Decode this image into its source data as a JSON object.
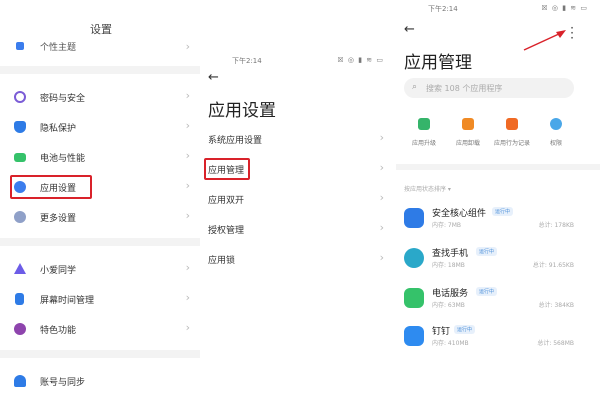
{
  "colors": {
    "highlight": "#d9222a",
    "accent": "#3b7ded"
  },
  "panel1": {
    "title": "设置",
    "cut_row": {
      "label": "个性主题",
      "icon": "brush-icon"
    },
    "groups": [
      [
        {
          "label": "密码与安全",
          "icon": "fingerprint-icon",
          "color": "#7b5cd6"
        },
        {
          "label": "隐私保护",
          "icon": "shield-icon",
          "color": "#2e7be6"
        },
        {
          "label": "电池与性能",
          "icon": "battery-icon",
          "color": "#35c26a"
        },
        {
          "label": "应用设置",
          "icon": "gear-icon",
          "color": "#3b7ded"
        },
        {
          "label": "更多设置",
          "icon": "more-icon",
          "color": "#7f8fa6"
        }
      ],
      [
        {
          "label": "小爱同学",
          "icon": "assistant-icon",
          "color": "#6c5ce7"
        },
        {
          "label": "屏幕时间管理",
          "icon": "hourglass-icon",
          "color": "#2e7be6"
        },
        {
          "label": "特色功能",
          "icon": "purple-drop-icon",
          "color": "#8e44ad"
        }
      ],
      [
        {
          "label": "账号与同步",
          "icon": "user-icon",
          "color": "#2e7be6"
        }
      ]
    ]
  },
  "panel2": {
    "status_time": "下午2:14",
    "status_icons": "☒ ◎ ▮ ≋ ▭",
    "title": "应用设置",
    "rows": [
      "系统应用设置",
      "应用管理",
      "应用双开",
      "授权管理",
      "应用锁"
    ]
  },
  "panel3": {
    "status_time": "下午2:14",
    "status_icons": "☒ ◎ ▮ ≋ ▭",
    "title": "应用管理",
    "search_placeholder": "搜索 108 个应用程序",
    "shortcuts": [
      {
        "label": "应用升级",
        "icon": "upgrade-icon",
        "color": "#35b46a"
      },
      {
        "label": "应用卸载",
        "icon": "trash-icon",
        "color": "#f08a24"
      },
      {
        "label": "应用行为记录",
        "icon": "record-icon",
        "color": "#f06a24"
      },
      {
        "label": "权限",
        "icon": "permission-icon",
        "color": "#4aa7e8"
      }
    ],
    "section_label": "按应用状态排序 ▾",
    "apps": [
      {
        "name": "安全核心组件",
        "tag": "运行中",
        "sub": "内存: 7MB",
        "size": "总计: 178KB",
        "icon": "security-core-icon",
        "color": "#2e7be6"
      },
      {
        "name": "查找手机",
        "tag": "运行中",
        "sub": "内存: 18MB",
        "size": "总计: 91.65KB",
        "icon": "find-phone-icon",
        "color": "#2aa8c9"
      },
      {
        "name": "电话服务",
        "tag": "运行中",
        "sub": "内存: 63MB",
        "size": "总计: 384KB",
        "icon": "phone-icon",
        "color": "#35c26a"
      },
      {
        "name": "钉钉",
        "tag": "运行中",
        "sub": "内存: 410MB",
        "size": "总计: 568MB",
        "icon": "dingtalk-icon",
        "color": "#2e8bf0"
      }
    ]
  }
}
